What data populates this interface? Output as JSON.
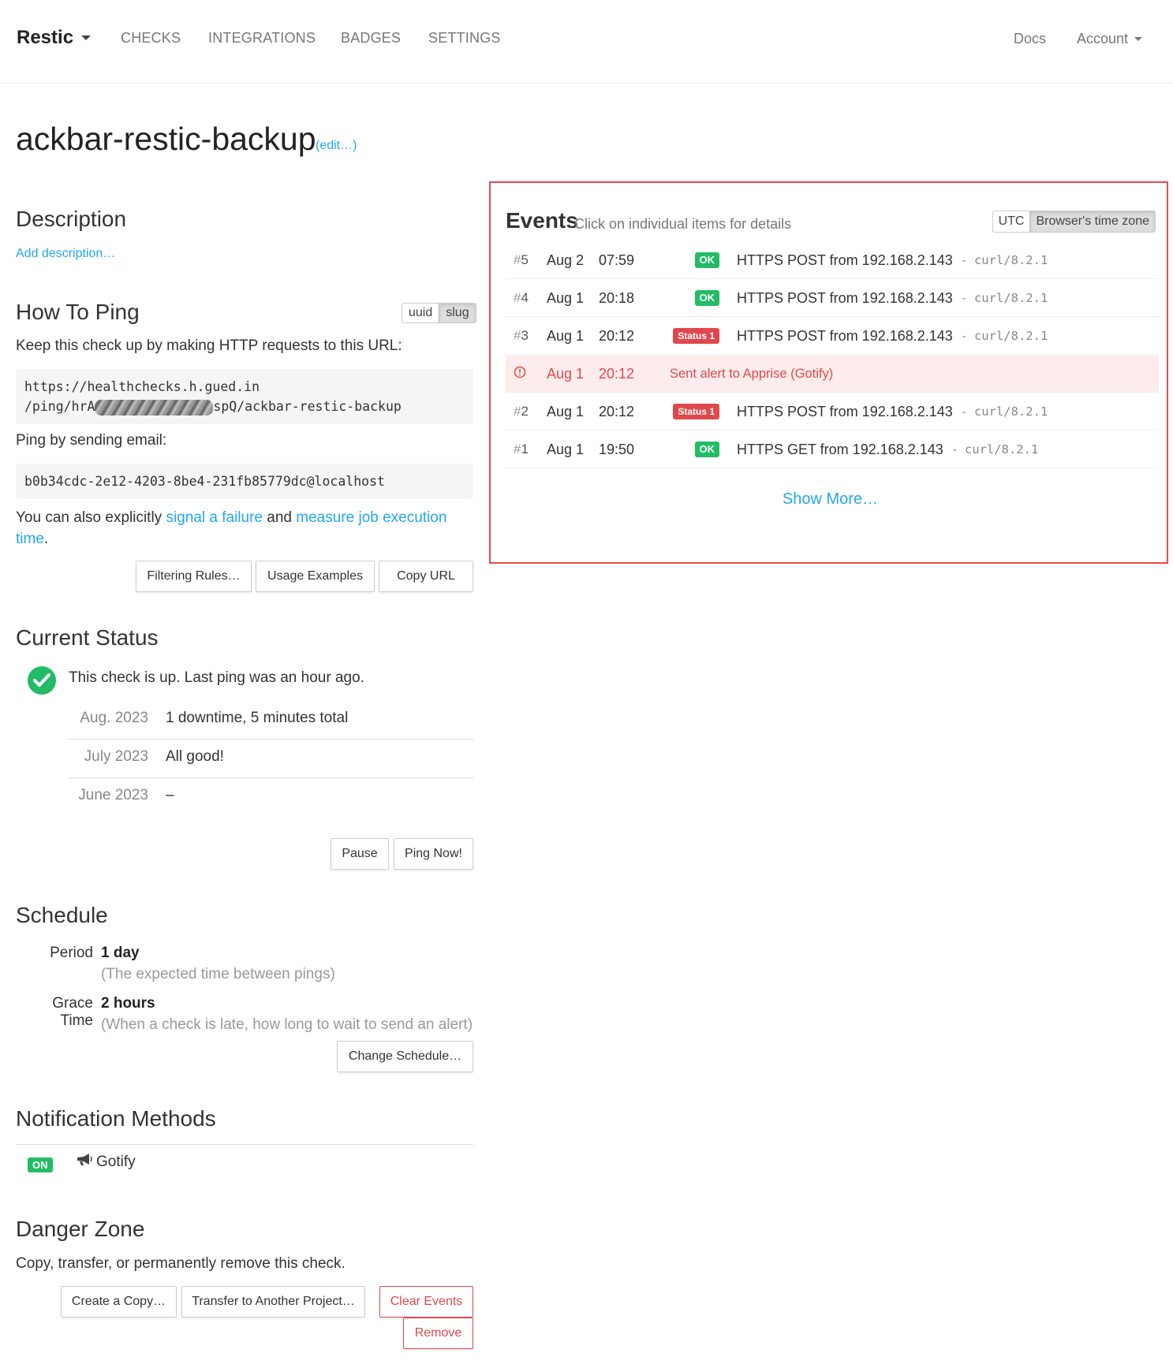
{
  "navbar": {
    "brand": "Restic",
    "items": [
      "CHECKS",
      "INTEGRATIONS",
      "BADGES",
      "SETTINGS"
    ],
    "docs": "Docs",
    "account": "Account"
  },
  "check": {
    "name": "ackbar-restic-backup",
    "edit_label": "(edit…)"
  },
  "description": {
    "heading": "Description",
    "add_link": "Add description…"
  },
  "how_to_ping": {
    "heading": "How To Ping",
    "toggle": [
      "uuid",
      "slug"
    ],
    "toggle_active": "slug",
    "intro": "Keep this check up by making HTTP requests to this URL:",
    "url_line1": "https://healthchecks.h.gued.in",
    "url_line2_prefix": "/ping/hrA",
    "url_line2_suffix": "spQ/ackbar-restic-backup",
    "email_intro": "Ping by sending email:",
    "email": "b0b34cdc-2e12-4203-8be4-231fb85779dc@localhost",
    "also_prefix": "You can also explicitly ",
    "signal_failure": "signal a failure",
    "also_and": " and ",
    "measure_link": "measure job execution time",
    "also_end": ".",
    "buttons": [
      "Filtering Rules…",
      "Usage Examples",
      "Copy URL"
    ]
  },
  "current_status": {
    "heading": "Current Status",
    "status_text": "This check is up. Last ping was an hour ago.",
    "periods": [
      {
        "month": "Aug. 2023",
        "text": "1 downtime, 5 minutes total"
      },
      {
        "month": "July 2023",
        "text": "All good!"
      },
      {
        "month": "June 2023",
        "text": "–"
      }
    ],
    "buttons": [
      "Pause",
      "Ping Now!"
    ]
  },
  "schedule": {
    "heading": "Schedule",
    "period_label": "Period",
    "period_value": "1 day",
    "period_help": "(The expected time between pings)",
    "grace_label": "Grace Time",
    "grace_value": "2 hours",
    "grace_help": "(When a check is late, how long to wait to send an alert)",
    "button": "Change Schedule…"
  },
  "notifications": {
    "heading": "Notification Methods",
    "state": "ON",
    "method": "Gotify"
  },
  "danger": {
    "heading": "Danger Zone",
    "text": "Copy, transfer, or permanently remove this check.",
    "buttons": [
      "Create a Copy…",
      "Transfer to Another Project…",
      "Clear Events",
      "Remove"
    ]
  },
  "events": {
    "heading": "Events",
    "subheading": "Click on individual items for details",
    "tz": [
      "UTC",
      "Browser's time zone"
    ],
    "tz_active": "Browser's time zone",
    "rows": [
      {
        "num": "5",
        "date": "Aug 2",
        "time": "07:59",
        "badge": "OK",
        "msg": "HTTPS POST from 192.168.2.143",
        "ua": "curl/8.2.1"
      },
      {
        "num": "4",
        "date": "Aug 1",
        "time": "20:18",
        "badge": "OK",
        "msg": "HTTPS POST from 192.168.2.143",
        "ua": "curl/8.2.1"
      },
      {
        "num": "3",
        "date": "Aug 1",
        "time": "20:12",
        "badge": "Status 1",
        "msg": "HTTPS POST from 192.168.2.143",
        "ua": "curl/8.2.1"
      },
      {
        "num": "",
        "date": "Aug 1",
        "time": "20:12",
        "badge": "",
        "msg": "Sent alert to Apprise (Gotify)",
        "ua": ""
      },
      {
        "num": "2",
        "date": "Aug 1",
        "time": "20:12",
        "badge": "Status 1",
        "msg": "HTTPS POST from 192.168.2.143",
        "ua": "curl/8.2.1"
      },
      {
        "num": "1",
        "date": "Aug 1",
        "time": "19:50",
        "badge": "OK",
        "msg": "HTTPS GET from 192.168.2.143",
        "ua": "curl/8.2.1"
      }
    ],
    "show_more": "Show More…"
  },
  "colors": {
    "accent": "#22a7f0",
    "success": "#22bc66",
    "danger": "#e0484e"
  }
}
